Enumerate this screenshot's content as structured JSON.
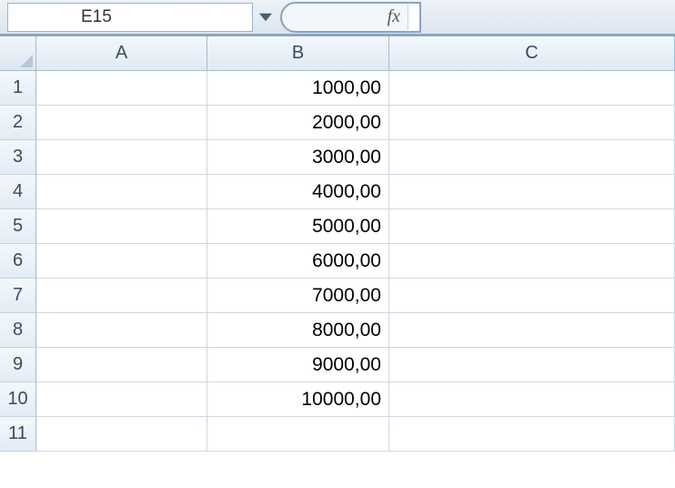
{
  "nameBox": "E15",
  "fxLabel": "fx",
  "formula": "",
  "columns": [
    "A",
    "B",
    "C"
  ],
  "rows": [
    "1",
    "2",
    "3",
    "4",
    "5",
    "6",
    "7",
    "8",
    "9",
    "10",
    "11"
  ],
  "cells": {
    "B1": "1000,00",
    "B2": "2000,00",
    "B3": "3000,00",
    "B4": "4000,00",
    "B5": "5000,00",
    "B6": "6000,00",
    "B7": "7000,00",
    "B8": "8000,00",
    "B9": "9000,00",
    "B10": "10000,00"
  }
}
